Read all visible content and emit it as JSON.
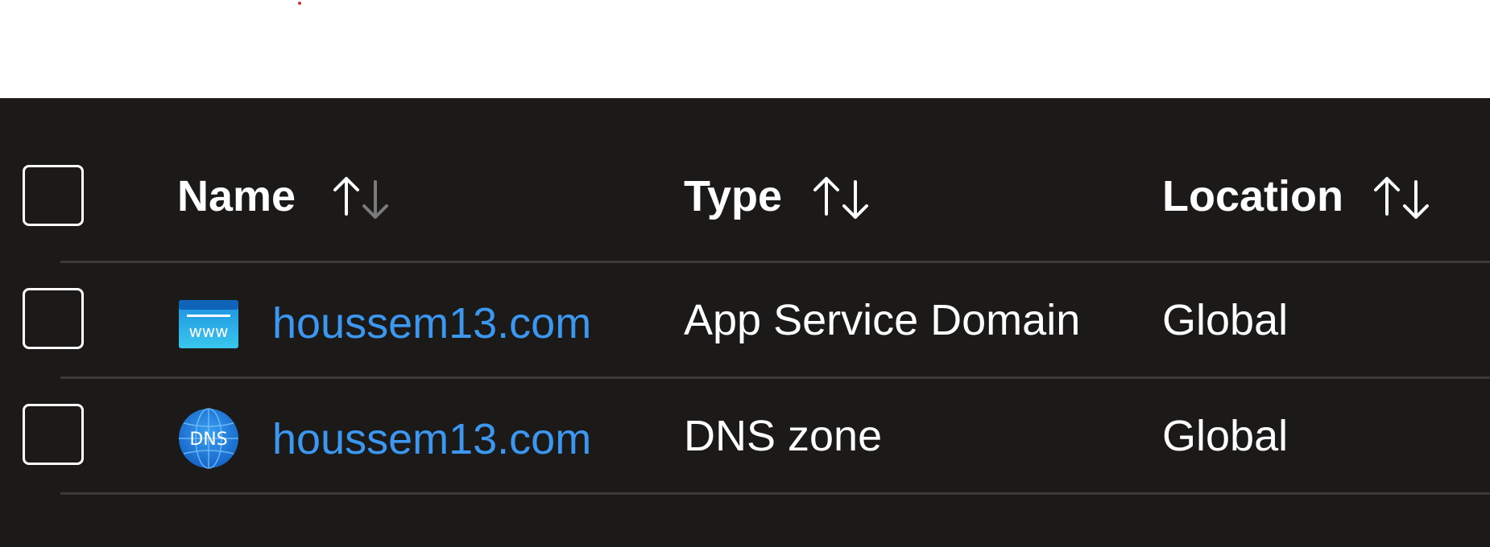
{
  "columns": {
    "name": "Name",
    "type": "Type",
    "location": "Location"
  },
  "rows": [
    {
      "name": "houssem13.com",
      "type": "App Service Domain",
      "location": "Global",
      "icon": "www-domain-icon",
      "icon_text": "www"
    },
    {
      "name": "houssem13.com",
      "type": "DNS zone",
      "location": "Global",
      "icon": "dns-zone-icon",
      "icon_text": "DNS"
    }
  ],
  "colors": {
    "background": "#1b1a19",
    "link": "#3b97f0",
    "divider": "#3b3a39",
    "text": "#ffffff"
  }
}
